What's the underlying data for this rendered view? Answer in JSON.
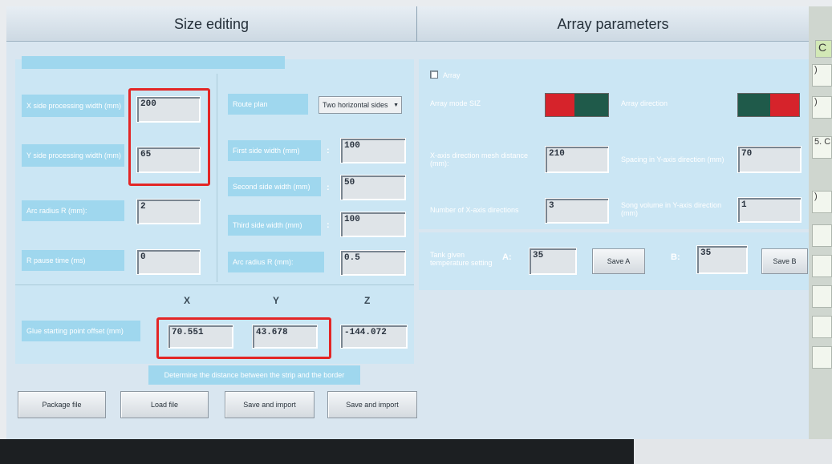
{
  "header": {
    "left_title": "Size editing",
    "right_title": "Array parameters"
  },
  "size": {
    "x_width_label": "X side processing width (mm)",
    "x_width_value": "200",
    "y_width_label": "Y side processing width (mm)",
    "y_width_value": "65",
    "arc_radius_label": "Arc radius R (mm):",
    "arc_radius_value": "2",
    "pause_label": "R pause time (ms)",
    "pause_value": "0"
  },
  "route": {
    "plan_label": "Route plan",
    "plan_value": "Two horizontal sides",
    "first_label": "First side width (mm)",
    "first_value": "100",
    "second_label": "Second side width (mm)",
    "second_value": "50",
    "third_label": "Third side width (mm)",
    "third_value": "100",
    "arc_label": "Arc radius R (mm):",
    "arc_value": "0.5",
    "colon": ":"
  },
  "offset": {
    "x_head": "X",
    "y_head": "Y",
    "z_head": "Z",
    "label": "Glue starting point offset (mm)",
    "x_value": "70.551",
    "y_value": "43.678",
    "z_value": "-144.072",
    "hint": "Determine the distance between the strip and the border"
  },
  "buttons": {
    "package": "Package file",
    "load": "Load file",
    "save_import_1": "Save and import",
    "save_import_2": "Save and import",
    "save_a": "Save A",
    "save_b": "Save B"
  },
  "array": {
    "checkbox_label": "Array",
    "mode_label": "Array mode SIZ",
    "direction_label": "Array direction",
    "x_mesh_label": "X-axis direction mesh distance (mm):",
    "x_mesh_value": "210",
    "y_spacing_label": "Spacing in Y-axis direction (mm)",
    "y_spacing_value": "70",
    "x_count_label": "Number of X-axis directions",
    "x_count_value": "3",
    "y_volume_label": "Song volume in Y-axis direction (mm)",
    "y_volume_value": "1"
  },
  "temperature": {
    "label": "Tank given temperature setting",
    "a_label": "A:",
    "a_value": "35",
    "b_label": "B:",
    "b_value": "35"
  },
  "sidebar": {
    "c": "C",
    "r1": ")",
    "r2": ")",
    "r3": "5. C",
    "r4": ")"
  },
  "colors": {
    "panel": "#cbe6f4",
    "label_strip": "#9fd7ee",
    "toggle_red": "#d6232b",
    "toggle_green": "#1f5a4a",
    "highlight": "#e32626"
  }
}
